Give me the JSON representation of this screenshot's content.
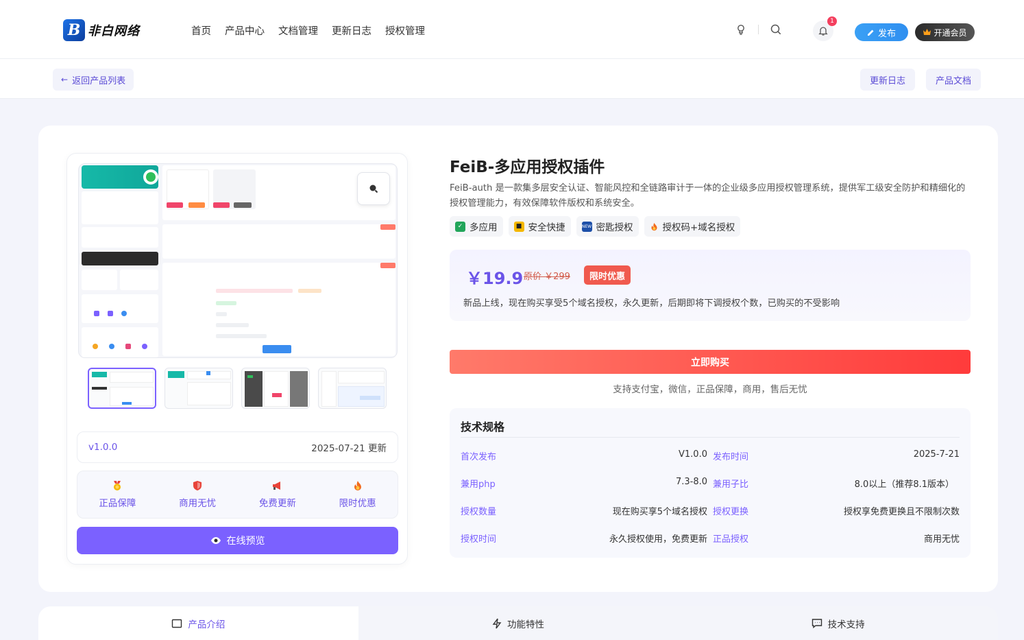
{
  "header": {
    "logo_mark": "B",
    "logo_text": "非白网络",
    "nav": [
      "首页",
      "产品中心",
      "文档管理",
      "更新日志",
      "授权管理"
    ],
    "notification_count": "1",
    "publish_label": "发布",
    "vip_label": "开通会员"
  },
  "subbar": {
    "back_label": "返回产品列表",
    "changelog_label": "更新日志",
    "docs_label": "产品文档"
  },
  "product": {
    "title": "FeiB-多应用授权插件",
    "description": "FeiB-auth 是一款集多层安全认证、智能风控和全链路审计于一体的企业级多应用授权管理系统，提供军工级安全防护和精细化的授权管理能力，有效保障软件版权和系统安全。",
    "tags": [
      {
        "icon": "check-icon",
        "label": "多应用",
        "color": "#22a55a"
      },
      {
        "icon": "lock-icon",
        "label": "安全快捷",
        "color": "#f5b800"
      },
      {
        "icon": "key-icon",
        "label": "密匙授权",
        "color": "#1d4fa8"
      },
      {
        "icon": "fire-icon",
        "label": "授权码+域名授权",
        "color": "#f26b1d"
      }
    ],
    "price": "￥19.9",
    "original_price": "原价 ￥299",
    "limit_badge": "限时优惠",
    "notice": "新品上线，现在购买享受5个域名授权，永久更新，后期即将下调授权个数，已购买的不受影响",
    "buy_label": "立即购买",
    "pay_info": "支持支付宝，微信，正品保障，商用，售后无忧"
  },
  "gallery": {
    "version": "v1.0.0",
    "update_date": "2025-07-21 更新",
    "features": [
      {
        "icon": "medal-icon",
        "label": "正品保障"
      },
      {
        "icon": "shield-icon",
        "label": "商用无忧"
      },
      {
        "icon": "megaphone-icon",
        "label": "免费更新"
      },
      {
        "icon": "fire-icon",
        "label": "限时优惠"
      }
    ],
    "preview_label": "在线预览",
    "thumbnails": 4
  },
  "spec": {
    "title": "技术规格",
    "rows": [
      [
        {
          "k": "首次发布",
          "v": "V1.0.0"
        },
        {
          "k": "发布时间",
          "v": "2025-7-21"
        }
      ],
      [
        {
          "k": "兼用php",
          "v": "7.3-8.0"
        },
        {
          "k": "兼用子比",
          "v": "8.0以上（推荐8.1版本）"
        }
      ],
      [
        {
          "k": "授权数量",
          "v": "现在购买享5个域名授权"
        },
        {
          "k": "授权更换",
          "v": "授权享免费更换且不限制次数"
        }
      ],
      [
        {
          "k": "授权时间",
          "v": "永久授权使用，免费更新"
        },
        {
          "k": "正品授权",
          "v": "商用无忧"
        }
      ]
    ]
  },
  "tabs": [
    {
      "icon": "book-icon",
      "label": "产品介绍"
    },
    {
      "icon": "bolt-icon",
      "label": "功能特性"
    },
    {
      "icon": "chat-icon",
      "label": "技术支持"
    }
  ],
  "colors": {
    "accent": "#7b61ff",
    "buy": "#ff3b3b",
    "publish": "#2f8ff0"
  }
}
